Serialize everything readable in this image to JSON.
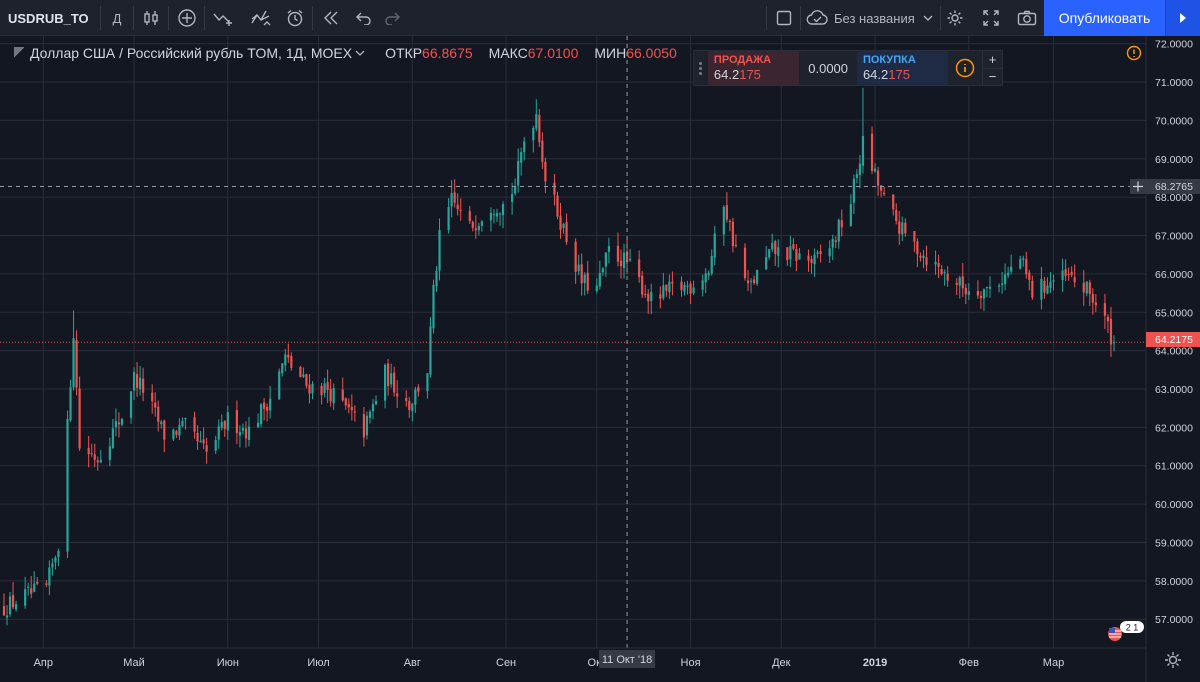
{
  "toolbar": {
    "symbol": "USDRUB_TO",
    "interval": "Д",
    "layout_name": "Без названия",
    "publish_label": "Опубликовать"
  },
  "legend": {
    "title": "Доллар США / Российский рубль TOM, 1Д, MOEX",
    "open_label": "ОТКР",
    "open_value": "66.8675",
    "high_label": "МАКС",
    "high_value": "67.0100",
    "low_label": "МИН",
    "low_value": "66.0050"
  },
  "trade": {
    "sell_label": "ПРОДАЖА",
    "sell_price": "64.2",
    "sell_price_hi": "175",
    "spread": "0.0000",
    "buy_label": "ПОКУПКА",
    "buy_price": "64.2",
    "buy_price_hi": "175",
    "plus": "+",
    "minus": "−"
  },
  "colors": {
    "background": "#131722",
    "grid": "#2a2e39",
    "up": "#26a69a",
    "down": "#ef5350",
    "text": "#d1d4dc",
    "accent": "#2962ff"
  },
  "axis": {
    "crosshair_price": "68.2765",
    "last_price": "64.2175",
    "crosshair_date": "11 Окт '18",
    "badge": "2 1"
  },
  "chart_data": {
    "type": "candlestick",
    "title": "Доллар США / Российский рубль TOM, 1Д, MOEX",
    "ylim": [
      56.25,
      72.2
    ],
    "y_ticks": [
      "72.0000",
      "71.0000",
      "70.0000",
      "69.0000",
      "68.0000",
      "67.0000",
      "66.0000",
      "65.0000",
      "64.0000",
      "63.0000",
      "62.0000",
      "61.0000",
      "60.0000",
      "59.0000",
      "58.0000",
      "57.0000"
    ],
    "x_ticks": [
      {
        "label": "Апр",
        "date": "2018-04-01"
      },
      {
        "label": "Май",
        "date": "2018-05-01"
      },
      {
        "label": "Июн",
        "date": "2018-06-01"
      },
      {
        "label": "Июл",
        "date": "2018-07-01"
      },
      {
        "label": "Авг",
        "date": "2018-08-01"
      },
      {
        "label": "Сен",
        "date": "2018-09-01"
      },
      {
        "label": "Окт",
        "date": "2018-10-01"
      },
      {
        "label": "Ноя",
        "date": "2018-11-01"
      },
      {
        "label": "Дек",
        "date": "2018-12-01"
      },
      {
        "label": "2019",
        "date": "2019-01-01"
      },
      {
        "label": "Фев",
        "date": "2019-02-01"
      },
      {
        "label": "Мар",
        "date": "2019-03-01"
      }
    ],
    "x_range": [
      "2018-03-19",
      "2019-03-21"
    ],
    "crosshair": {
      "date": "2018-10-11",
      "price": 68.2765
    },
    "last_price": 64.2175,
    "close_keypoints": [
      [
        "2018-03-19",
        57.3
      ],
      [
        "2018-03-26",
        57.6
      ],
      [
        "2018-04-02",
        57.8
      ],
      [
        "2018-04-06",
        59.0
      ],
      [
        "2018-04-09",
        62.0
      ],
      [
        "2018-04-11",
        64.5
      ],
      [
        "2018-04-13",
        61.5
      ],
      [
        "2018-04-19",
        61.2
      ],
      [
        "2018-04-27",
        62.3
      ],
      [
        "2018-05-01",
        63.3
      ],
      [
        "2018-05-04",
        63.0
      ],
      [
        "2018-05-11",
        61.8
      ],
      [
        "2018-05-18",
        62.0
      ],
      [
        "2018-05-25",
        61.3
      ],
      [
        "2018-06-01",
        62.2
      ],
      [
        "2018-06-08",
        61.9
      ],
      [
        "2018-06-15",
        62.8
      ],
      [
        "2018-06-20",
        63.8
      ],
      [
        "2018-06-27",
        63.1
      ],
      [
        "2018-07-04",
        63.0
      ],
      [
        "2018-07-11",
        62.4
      ],
      [
        "2018-07-16",
        61.9
      ],
      [
        "2018-07-23",
        63.4
      ],
      [
        "2018-07-31",
        62.6
      ],
      [
        "2018-08-06",
        63.5
      ],
      [
        "2018-08-08",
        65.5
      ],
      [
        "2018-08-10",
        66.9
      ],
      [
        "2018-08-14",
        67.9
      ],
      [
        "2018-08-20",
        67.2
      ],
      [
        "2018-08-27",
        67.8
      ],
      [
        "2018-08-31",
        67.8
      ],
      [
        "2018-09-04",
        68.3
      ],
      [
        "2018-09-07",
        69.5
      ],
      [
        "2018-09-11",
        70.2
      ],
      [
        "2018-09-14",
        68.5
      ],
      [
        "2018-09-19",
        67.4
      ],
      [
        "2018-09-26",
        65.8
      ],
      [
        "2018-10-01",
        65.6
      ],
      [
        "2018-10-05",
        66.6
      ],
      [
        "2018-10-11",
        66.3
      ],
      [
        "2018-10-15",
        65.8
      ],
      [
        "2018-10-19",
        65.3
      ],
      [
        "2018-10-26",
        65.6
      ],
      [
        "2018-11-01",
        65.7
      ],
      [
        "2018-11-07",
        66.1
      ],
      [
        "2018-11-12",
        67.9
      ],
      [
        "2018-11-15",
        66.9
      ],
      [
        "2018-11-20",
        65.6
      ],
      [
        "2018-11-28",
        66.6
      ],
      [
        "2018-12-05",
        66.5
      ],
      [
        "2018-12-12",
        66.3
      ],
      [
        "2018-12-18",
        66.8
      ],
      [
        "2018-12-24",
        67.9
      ],
      [
        "2018-12-28",
        69.4
      ],
      [
        "2019-01-04",
        67.9
      ],
      [
        "2019-01-10",
        67.1
      ],
      [
        "2019-01-17",
        66.5
      ],
      [
        "2019-01-24",
        66.0
      ],
      [
        "2019-01-31",
        65.6
      ],
      [
        "2019-02-07",
        65.6
      ],
      [
        "2019-02-14",
        66.0
      ],
      [
        "2019-02-18",
        66.4
      ],
      [
        "2019-02-22",
        65.5
      ],
      [
        "2019-02-28",
        65.8
      ],
      [
        "2019-03-06",
        65.9
      ],
      [
        "2019-03-13",
        65.5
      ],
      [
        "2019-03-18",
        64.8
      ],
      [
        "2019-03-21",
        64.2
      ]
    ]
  }
}
